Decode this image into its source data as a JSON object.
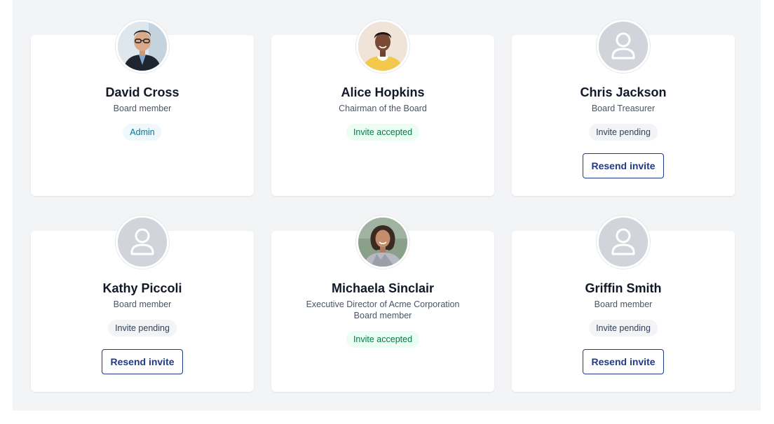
{
  "members": [
    {
      "name": "David Cross",
      "roles": [
        "Board member"
      ],
      "status": "Admin",
      "status_kind": "admin",
      "avatar": "photo-man-glasses",
      "resend_label": ""
    },
    {
      "name": "Alice Hopkins",
      "roles": [
        "Chairman of the Board"
      ],
      "status": "Invite accepted",
      "status_kind": "accepted",
      "avatar": "photo-woman-yellow",
      "resend_label": ""
    },
    {
      "name": "Chris Jackson",
      "roles": [
        "Board Treasurer"
      ],
      "status": "Invite pending",
      "status_kind": "pending",
      "avatar": "user-placeholder-icon",
      "resend_label": "Resend invite"
    },
    {
      "name": "Kathy Piccoli",
      "roles": [
        "Board member"
      ],
      "status": "Invite pending",
      "status_kind": "pending",
      "avatar": "user-placeholder-icon",
      "resend_label": "Resend invite"
    },
    {
      "name": "Michaela Sinclair",
      "roles": [
        "Executive Director of Acme Corporation",
        "Board member"
      ],
      "status": "Invite accepted",
      "status_kind": "accepted",
      "avatar": "photo-woman-curly",
      "resend_label": ""
    },
    {
      "name": "Griffin Smith",
      "roles": [
        "Board member"
      ],
      "status": "Invite pending",
      "status_kind": "pending",
      "avatar": "user-placeholder-icon",
      "resend_label": "Resend invite"
    }
  ],
  "colors": {
    "background": "#f3f4f6",
    "card": "#ffffff",
    "accent": "#1e3a8a",
    "admin_badge_text": "#0e7490",
    "accepted_badge_text": "#067647"
  }
}
